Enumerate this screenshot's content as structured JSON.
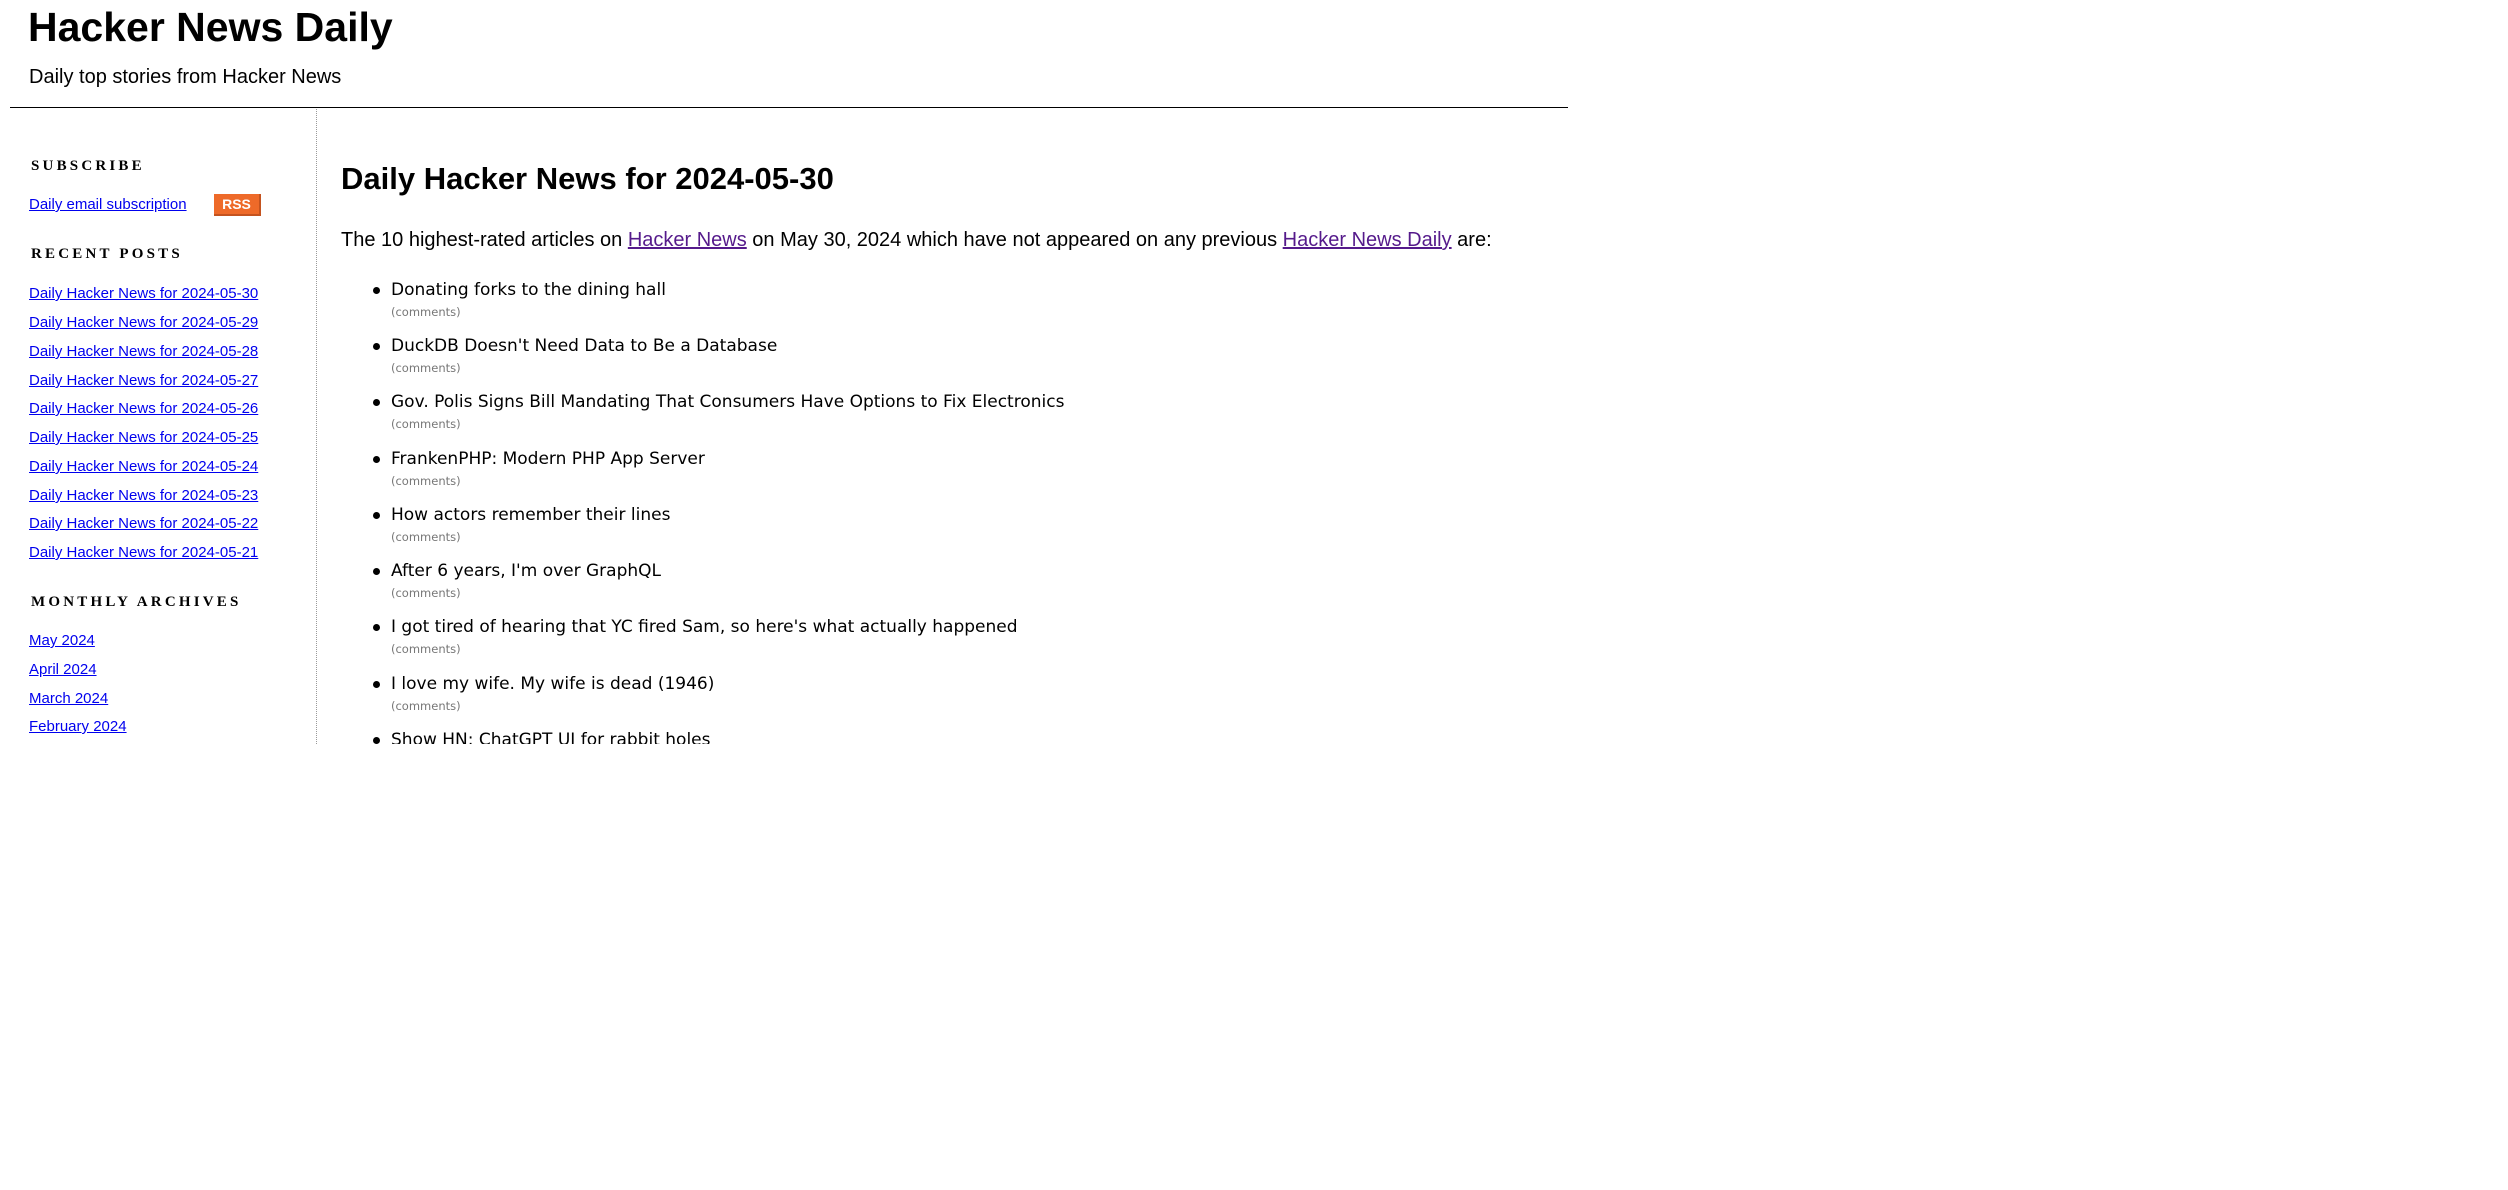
{
  "header": {
    "title": "Hacker News Daily",
    "tagline": "Daily top stories from Hacker News"
  },
  "sidebar": {
    "subscribe": {
      "heading": "SUBSCRIBE",
      "email_link": "Daily email subscription",
      "rss_label": "RSS"
    },
    "recent_posts": {
      "heading": "RECENT POSTS",
      "items": [
        "Daily Hacker News for 2024-05-30",
        "Daily Hacker News for 2024-05-29",
        "Daily Hacker News for 2024-05-28",
        "Daily Hacker News for 2024-05-27",
        "Daily Hacker News for 2024-05-26",
        "Daily Hacker News for 2024-05-25",
        "Daily Hacker News for 2024-05-24",
        "Daily Hacker News for 2024-05-23",
        "Daily Hacker News for 2024-05-22",
        "Daily Hacker News for 2024-05-21"
      ]
    },
    "monthly_archives": {
      "heading": "MONTHLY ARCHIVES",
      "items": [
        "May 2024",
        "April 2024",
        "March 2024",
        "February 2024"
      ]
    }
  },
  "main": {
    "title": "Daily Hacker News for 2024-05-30",
    "intro": {
      "before": "The 10 highest-rated articles on ",
      "link1": "Hacker News",
      "middle": " on May 30, 2024 which have not appeared on any previous ",
      "link2": "Hacker News Daily",
      "after": " are:"
    },
    "comments_label": "(comments)",
    "stories": [
      "Donating forks to the dining hall",
      "DuckDB Doesn't Need Data to Be a Database",
      "Gov. Polis Signs Bill Mandating That Consumers Have Options to Fix Electronics",
      "FrankenPHP: Modern PHP App Server",
      "How actors remember their lines",
      "After 6 years, I'm over GraphQL",
      "I got tired of hearing that YC fired Sam, so here's what actually happened",
      "I love my wife. My wife is dead (1946)",
      "Show HN: ChatGPT UI for rabbit holes"
    ]
  },
  "colors": {
    "link": "#0000ee",
    "visited_link": "#551a8b",
    "rss_button": "#ee6a29",
    "comments_text": "#777777",
    "divider": "#9a9a9a"
  }
}
